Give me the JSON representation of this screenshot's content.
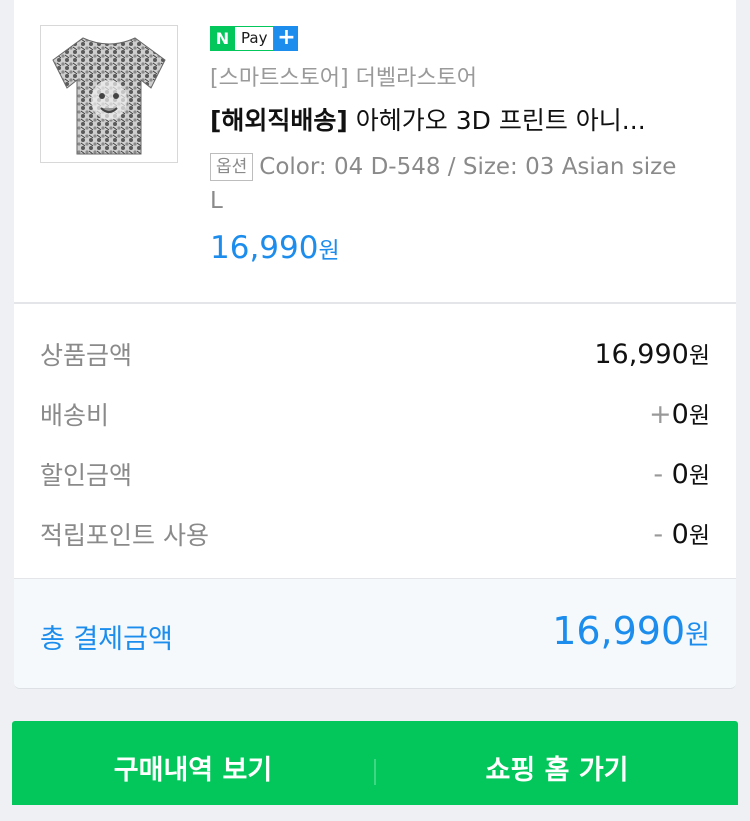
{
  "product": {
    "npay_n": "N",
    "npay_pay": "Pay",
    "npay_plus": "+",
    "store": "[스마트스토어] 더벨라스토어",
    "title_tag": "[해외직배송]",
    "title_rest": " 아헤가오 3D 프린트 아니...",
    "option_badge": "옵션",
    "option_text": "Color: 04 D-548 / Size: 03 Asian size L",
    "price": "16,990",
    "price_unit": "원"
  },
  "summary": {
    "rows": [
      {
        "label": "상품금액",
        "sign": "",
        "value": "16,990",
        "unit": "원"
      },
      {
        "label": "배송비",
        "sign": "+",
        "value": "0",
        "unit": "원"
      },
      {
        "label": "할인금액",
        "sign": "- ",
        "value": "0",
        "unit": "원"
      },
      {
        "label": "적립포인트 사용",
        "sign": "- ",
        "value": "0",
        "unit": "원"
      }
    ],
    "total_label": "총 결제금액",
    "total_value": "16,990",
    "total_unit": "원"
  },
  "buttons": {
    "history": "구매내역 보기",
    "shopping_home": "쇼핑 홈 가기"
  },
  "colors": {
    "accent_blue": "#1d8ded",
    "naver_green": "#03c75a"
  },
  "icons": {
    "product_thumbnail": "t-shirt-image"
  }
}
